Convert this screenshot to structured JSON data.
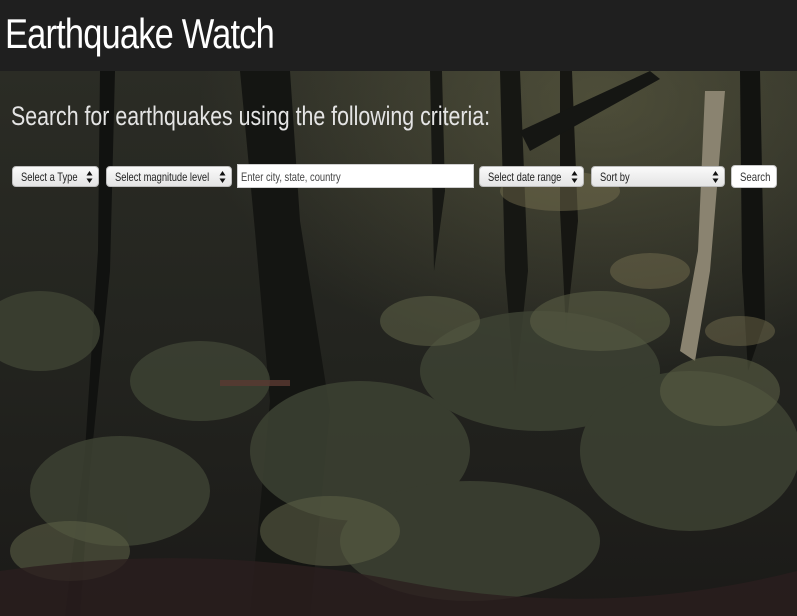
{
  "app": {
    "title": "Earthquake Watch"
  },
  "search": {
    "prompt": "Search for earthquakes using the following criteria:",
    "type_select": {
      "selected": "Select a Type"
    },
    "magnitude_select": {
      "selected": "Select magnitude level"
    },
    "location_input": {
      "value": "",
      "placeholder": "Enter city, state, country"
    },
    "date_select": {
      "selected": "Select date range"
    },
    "sort_select": {
      "selected": "Sort by"
    },
    "search_button": {
      "label": "Search"
    }
  },
  "icons": {
    "select_arrow": "up-down-arrows-icon"
  },
  "colors": {
    "header_bg": "#1f1f1f",
    "title_text": "#ffffff",
    "background_photo": "#1e1f1a"
  }
}
